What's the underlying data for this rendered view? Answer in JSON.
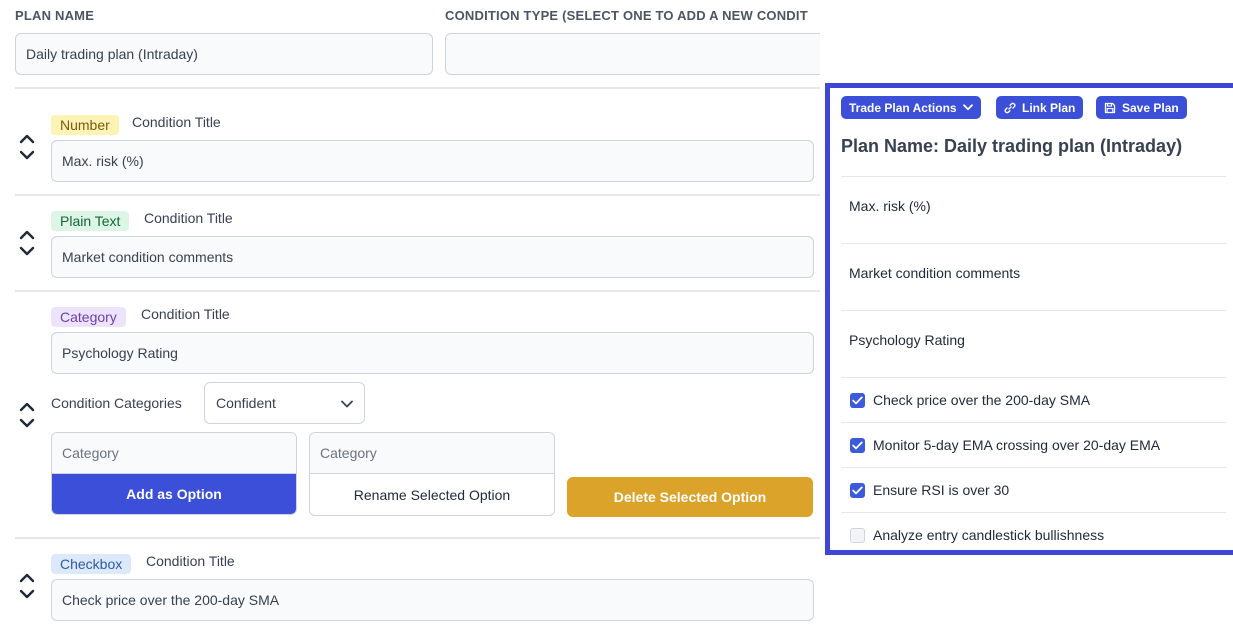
{
  "header": {
    "plan_name_label": "PLAN NAME",
    "condition_type_label": "CONDITION TYPE (SELECT ONE TO ADD A NEW CONDIT",
    "plan_name_value": "Daily trading plan (Intraday)"
  },
  "conditions": [
    {
      "badge": "Number",
      "title_label": "Condition Title",
      "value": "Max. risk (%)"
    },
    {
      "badge": "Plain Text",
      "title_label": "Condition Title",
      "value": "Market condition comments"
    },
    {
      "badge": "Category",
      "title_label": "Condition Title",
      "value": "Psychology Rating"
    },
    {
      "badge": "Checkbox",
      "title_label": "Condition Title",
      "value": "Check price over the 200-day SMA"
    }
  ],
  "category_editor": {
    "label": "Condition Categories",
    "selected": "Confident",
    "input_placeholder_1": "Category",
    "input_placeholder_2": "Category",
    "add_button": "Add as Option",
    "rename_button": "Rename Selected Option",
    "delete_button": "Delete Selected Option"
  },
  "preview": {
    "actions_button": "Trade Plan Actions",
    "link_button": "Link Plan",
    "save_button": "Save Plan",
    "title": "Plan Name: Daily trading plan (Intraday)",
    "text_items": [
      "Max. risk (%)",
      "Market condition comments",
      "Psychology Rating"
    ],
    "checkbox_items": [
      {
        "label": "Check price over the 200-day SMA",
        "checked": true
      },
      {
        "label": "Monitor 5-day EMA crossing over 20-day EMA",
        "checked": true
      },
      {
        "label": "Ensure RSI is over 30",
        "checked": true
      },
      {
        "label": "Analyze entry candlestick bullishness",
        "checked": false
      }
    ]
  },
  "colors": {
    "accent": "#3b4fd8",
    "panel_border": "#3f46d6",
    "delete": "#dba32a",
    "badge_number_bg": "#fdf3b4",
    "badge_text_bg": "#dcf5e6",
    "badge_category_bg": "#ede4fb",
    "badge_checkbox_bg": "#dbe9fb"
  }
}
